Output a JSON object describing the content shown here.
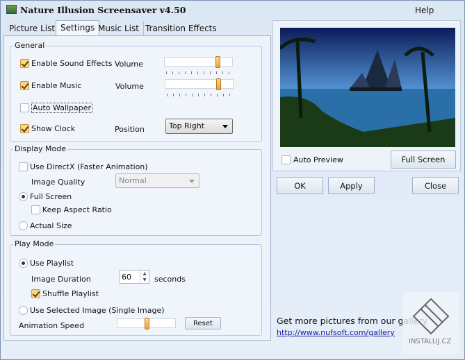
{
  "window": {
    "title": "Nature Illusion Screensaver v4.50",
    "help": "Help"
  },
  "tabs": [
    {
      "label": "Picture List"
    },
    {
      "label": "Settings",
      "active": true
    },
    {
      "label": "Music List"
    },
    {
      "label": "Transition Effects"
    }
  ],
  "general": {
    "label": "General",
    "sound_effects": {
      "label": "Enable Sound Effects",
      "checked": true,
      "volume_label": "Volume",
      "volume": 78
    },
    "music": {
      "label": "Enable Music",
      "checked": true,
      "volume_label": "Volume",
      "volume": 78
    },
    "auto_wallpaper": {
      "label": "Auto Wallpaper",
      "checked": false
    },
    "show_clock": {
      "label": "Show Clock",
      "checked": true,
      "position_label": "Position",
      "position": "Top Right"
    }
  },
  "display": {
    "label": "Display Mode",
    "directx": {
      "label": "Use DirectX (Faster Animation)",
      "checked": false
    },
    "quality_label": "Image Quality",
    "quality": "Normal",
    "full_screen": "Full Screen",
    "keep_aspect": "Keep Aspect Ratio",
    "actual_size": "Actual Size",
    "selected": "Full Screen"
  },
  "play": {
    "label": "Play Mode",
    "use_playlist": "Use Playlist",
    "duration_label": "Image Duration",
    "duration": "60",
    "duration_unit": "seconds",
    "shuffle": "Shuffle Playlist",
    "shuffle_checked": true,
    "single": "Use Selected Image (Single Image)",
    "speed_label": "Animation Speed",
    "speed": 50,
    "reset": "Reset"
  },
  "preview": {
    "auto_preview": "Auto Preview",
    "auto_checked": false,
    "full_screen": "Full Screen"
  },
  "buttons": {
    "ok": "OK",
    "apply": "Apply",
    "close": "Close"
  },
  "gallery": {
    "text": "Get more pictures from our gallery",
    "link": "http://www.nufsoft.com/gallery"
  },
  "watermark": "INSTALUJ.CZ"
}
